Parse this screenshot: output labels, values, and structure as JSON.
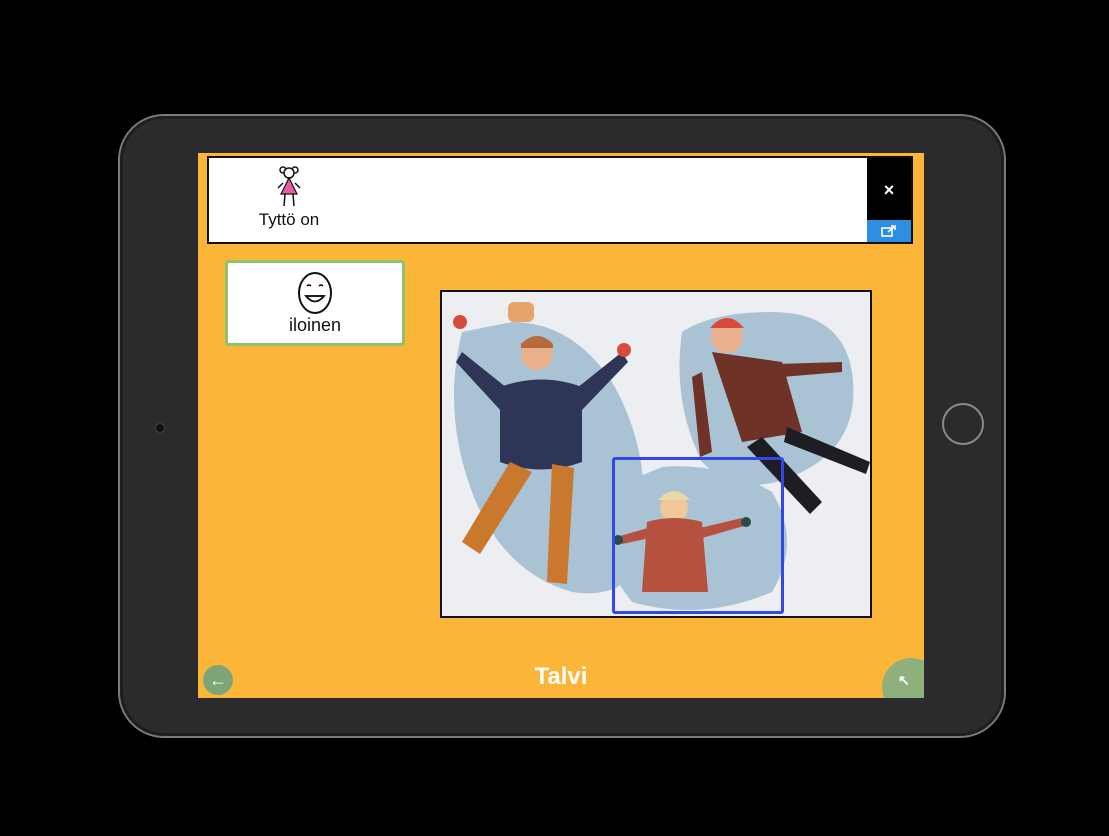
{
  "sentence_bar": {
    "words": [
      {
        "label": "Tyttö on",
        "icon": "girl-icon"
      }
    ],
    "clear_label": "×",
    "share_icon": "share-icon"
  },
  "symbols": [
    {
      "label": "iloinen",
      "icon": "happy-face-icon"
    }
  ],
  "scene": {
    "hotspot_icon": "selection-frame"
  },
  "footer": {
    "title": "Talvi",
    "back_icon": "back-arrow-icon",
    "corner_icon": "navigate-icon"
  },
  "colors": {
    "background": "#fbb63a",
    "hotspot": "#3448e6",
    "symbol_border": "#8cc46a",
    "share": "#2e8fe0"
  }
}
